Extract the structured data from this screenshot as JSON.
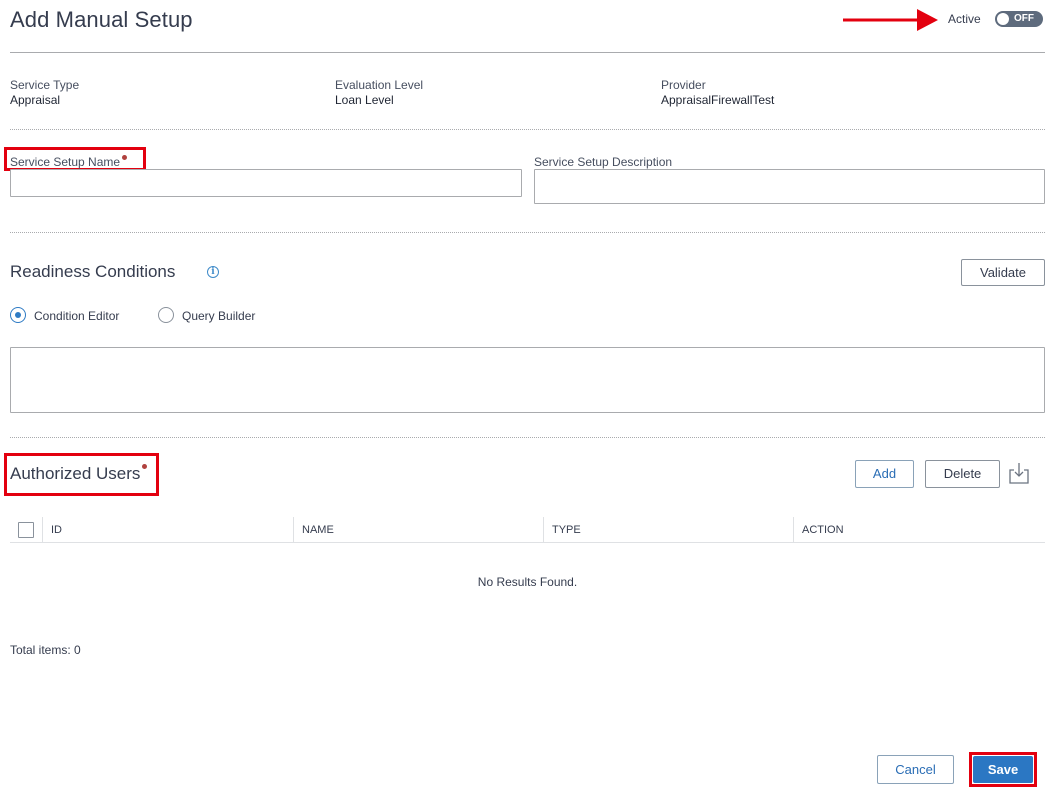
{
  "header": {
    "title": "Add Manual Setup",
    "active_label": "Active",
    "toggle_state": "OFF"
  },
  "info": [
    {
      "label": "Service Type",
      "value": "Appraisal"
    },
    {
      "label": "Evaluation Level",
      "value": "Loan Level"
    },
    {
      "label": "Provider",
      "value": "AppraisalFirewallTest"
    }
  ],
  "form": {
    "name_label": "Service Setup Name",
    "name_value": "",
    "description_label": "Service Setup Description",
    "description_value": ""
  },
  "readiness": {
    "title": "Readiness Conditions",
    "info_icon": "i",
    "validate_label": "Validate",
    "options": [
      {
        "label": "Condition Editor",
        "selected": true
      },
      {
        "label": "Query Builder",
        "selected": false
      }
    ],
    "editor_value": ""
  },
  "users": {
    "title": "Authorized Users",
    "add_label": "Add",
    "delete_label": "Delete",
    "columns": [
      "ID",
      "NAME",
      "TYPE",
      "ACTION"
    ],
    "empty_message": "No Results Found.",
    "total_label": "Total items: 0"
  },
  "footer": {
    "cancel_label": "Cancel",
    "save_label": "Save"
  },
  "colors": {
    "accent": "#2b77c3",
    "annotation": "#e3000f",
    "required": "#b0413e"
  }
}
